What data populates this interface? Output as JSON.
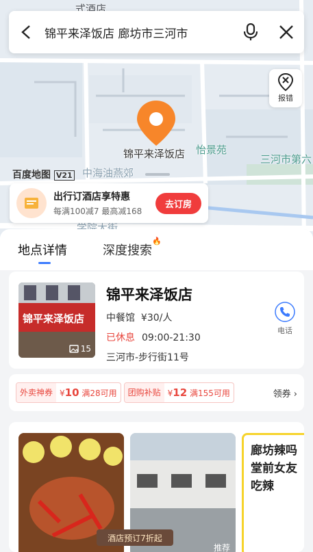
{
  "search": {
    "query": "锦平来泽饭店 廊坊市三河市"
  },
  "map": {
    "poi_name": "锦平来泽饭店",
    "labels": [
      "怡景苑",
      "三河市第六",
      "中海油燕郊",
      "学院大街",
      "式酒店"
    ],
    "logo": "百度地图",
    "logo_badge": "V21",
    "report_label": "报错"
  },
  "promo": {
    "title": "出行订酒店享特惠",
    "subtitle": "每满100减7 最高减168",
    "button": "去订房"
  },
  "tabs": [
    {
      "label": "地点详情"
    },
    {
      "label": "深度搜索"
    }
  ],
  "place": {
    "name": "锦平来泽饭店",
    "category": "中餐馆",
    "price": "¥30/人",
    "status": "已休息",
    "hours": "09:00-21:30",
    "address": "三河市-步行街11号",
    "photo_count": "15",
    "phone_label": "电话",
    "sign_text": "锦平来泽饭店"
  },
  "coupons": [
    {
      "tag": "外卖神券",
      "symbol": "¥",
      "amount": "10",
      "cond": "满28可用"
    },
    {
      "tag": "团购补贴",
      "symbol": "¥",
      "amount": "12",
      "cond": "满155可用"
    }
  ],
  "coupons_more": "领券 ›",
  "gallery": {
    "recommend_tag": "推荐",
    "banner": "酒店预订7折起",
    "ad_lines": [
      "廊坊辣吗",
      "堂前女友",
      "吃辣"
    ]
  },
  "colors": {
    "accent": "#3a7afe",
    "red": "#e8453c",
    "pin": "#f7862a"
  }
}
